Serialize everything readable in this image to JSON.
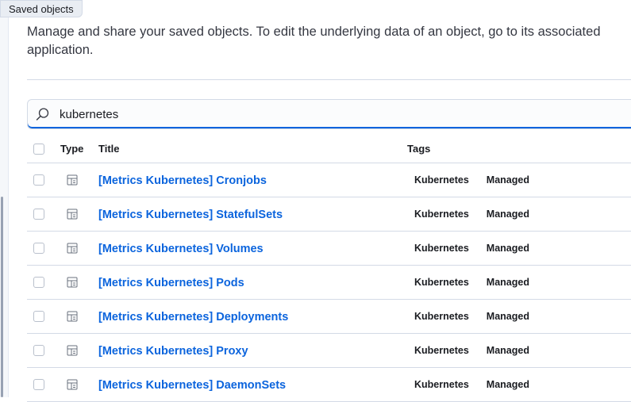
{
  "tooltip": {
    "label": "Saved objects"
  },
  "description": "Manage and share your saved objects. To edit the underlying data of an object, go to its associated application.",
  "search": {
    "value": "kubernetes"
  },
  "table": {
    "columns": {
      "type": "Type",
      "title": "Title",
      "tags": "Tags"
    },
    "rows": [
      {
        "title": "[Metrics Kubernetes] Cronjobs",
        "tags": [
          "Kubernetes",
          "Managed"
        ]
      },
      {
        "title": "[Metrics Kubernetes] StatefulSets",
        "tags": [
          "Kubernetes",
          "Managed"
        ]
      },
      {
        "title": "[Metrics Kubernetes] Volumes",
        "tags": [
          "Kubernetes",
          "Managed"
        ]
      },
      {
        "title": "[Metrics Kubernetes] Pods",
        "tags": [
          "Kubernetes",
          "Managed"
        ]
      },
      {
        "title": "[Metrics Kubernetes] Deployments",
        "tags": [
          "Kubernetes",
          "Managed"
        ]
      },
      {
        "title": "[Metrics Kubernetes] Proxy",
        "tags": [
          "Kubernetes",
          "Managed"
        ]
      },
      {
        "title": "[Metrics Kubernetes] DaemonSets",
        "tags": [
          "Kubernetes",
          "Managed"
        ]
      }
    ]
  },
  "icons": {
    "search": "search-icon",
    "row_type": "dashboard-icon"
  },
  "colors": {
    "link": "#0b64dd",
    "focus_underline": "#0b64dd",
    "text": "#343741"
  }
}
